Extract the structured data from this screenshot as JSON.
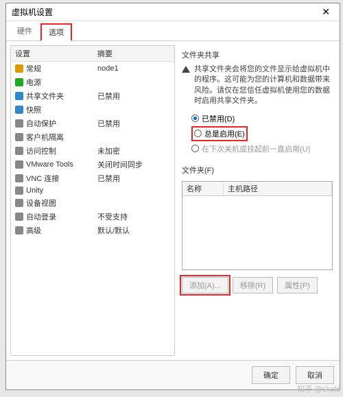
{
  "window": {
    "title": "虚拟机设置"
  },
  "tabs": {
    "hardware": "硬件",
    "options": "选项"
  },
  "leftHead": {
    "setting": "设置",
    "summary": "摘要"
  },
  "rows": [
    {
      "icon": "flag-icon",
      "name": "常规",
      "val": "node1",
      "c": "#d90"
    },
    {
      "icon": "play-icon",
      "name": "电源",
      "val": "",
      "c": "#2a2"
    },
    {
      "icon": "folder-icon",
      "name": "共享文件夹",
      "val": "已禁用",
      "c": "#38c"
    },
    {
      "icon": "camera-icon",
      "name": "快照",
      "val": "",
      "c": "#38c"
    },
    {
      "icon": "shield-icon",
      "name": "自动保护",
      "val": "已禁用",
      "c": "#888"
    },
    {
      "icon": "monitor-icon",
      "name": "客户机隔离",
      "val": "",
      "c": "#888"
    },
    {
      "icon": "lock-icon",
      "name": "访问控制",
      "val": "未加密",
      "c": "#888"
    },
    {
      "icon": "tools-icon",
      "name": "VMware Tools",
      "val": "关闭时间同步",
      "c": "#888"
    },
    {
      "icon": "vnc-icon",
      "name": "VNC 连接",
      "val": "已禁用",
      "c": "#888"
    },
    {
      "icon": "unity-icon",
      "name": "Unity",
      "val": "",
      "c": "#888"
    },
    {
      "icon": "device-icon",
      "name": "设备视图",
      "val": "",
      "c": "#888"
    },
    {
      "icon": "auto-icon",
      "name": "自动登录",
      "val": "不受支持",
      "c": "#888"
    },
    {
      "icon": "adv-icon",
      "name": "高级",
      "val": "默认/默认",
      "c": "#888"
    }
  ],
  "right": {
    "shareTitle": "文件夹共享",
    "hint": "共享文件夹会将您的文件显示给虚拟机中的程序。这可能为您的计算机和数据带来风险。请仅在您信任虚拟机使用您的数据时启用共享文件夹。",
    "radio1": "已禁用(D)",
    "radio2": "总是启用(E)",
    "radio3": "在下次关机或挂起前一直启用(U)",
    "folderTitle": "文件夹(F)",
    "colName": "名称",
    "colPath": "主机路径",
    "btnAdd": "添加(A)...",
    "btnRemove": "移除(R)",
    "btnProps": "属性(P)"
  },
  "footer": {
    "ok": "确定",
    "cancel": "取消"
  },
  "watermark": "知乎 @skate"
}
